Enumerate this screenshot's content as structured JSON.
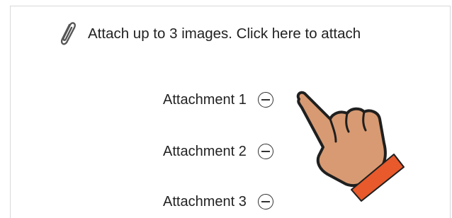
{
  "attach_bar": {
    "icon": "paperclip-icon",
    "text": "Attach up to 3 images. Click here to attach"
  },
  "attachments": [
    {
      "label": "Attachment 1",
      "remove_icon": "minus-circle-icon"
    },
    {
      "label": "Attachment 2",
      "remove_icon": "minus-circle-icon"
    },
    {
      "label": "Attachment 3",
      "remove_icon": "minus-circle-icon"
    }
  ],
  "pointer": {
    "icon": "pointing-hand-icon",
    "skin_color": "#d89a72",
    "cuff_color": "#e8592b"
  }
}
